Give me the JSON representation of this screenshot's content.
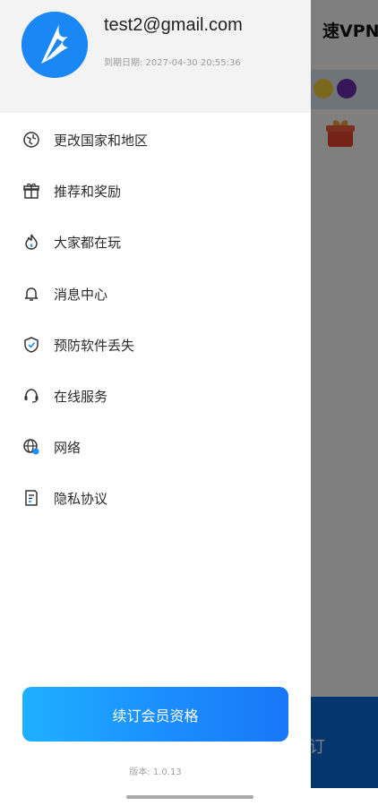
{
  "background": {
    "title_fragment": "速VPN",
    "bottom_fragment": "订"
  },
  "drawer": {
    "email": "test2@gmail.com",
    "expiry": "到期日期: 2027-04-30 20:55:36",
    "menu": [
      {
        "label": "更改国家和地区",
        "icon": "globe-icon"
      },
      {
        "label": "推荐和奖励",
        "icon": "gift-icon"
      },
      {
        "label": "大家都在玩",
        "icon": "flame-icon"
      },
      {
        "label": "消息中心",
        "icon": "bell-icon"
      },
      {
        "label": "预防软件丢失",
        "icon": "shield-check-icon"
      },
      {
        "label": "在线服务",
        "icon": "headset-icon"
      },
      {
        "label": "网络",
        "icon": "network-globe-icon"
      },
      {
        "label": "隐私协议",
        "icon": "document-icon"
      }
    ],
    "renew_label": "续订会员资格",
    "version": "版本: 1.0.13"
  },
  "colors": {
    "accent": "#1b8dff",
    "avatar": "#1a88f4",
    "header_bg": "#f3f3f3"
  }
}
